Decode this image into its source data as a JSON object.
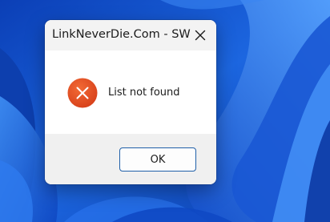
{
  "dialog": {
    "title": "LinkNeverDie.Com - SW",
    "message": "List not found",
    "ok_label": "OK",
    "icon": "error-icon",
    "close_icon": "close-icon"
  },
  "colors": {
    "error_red": "#e0491f",
    "accent": "#1f5fa8",
    "wallpaper_blue": "#1a5fd6"
  }
}
